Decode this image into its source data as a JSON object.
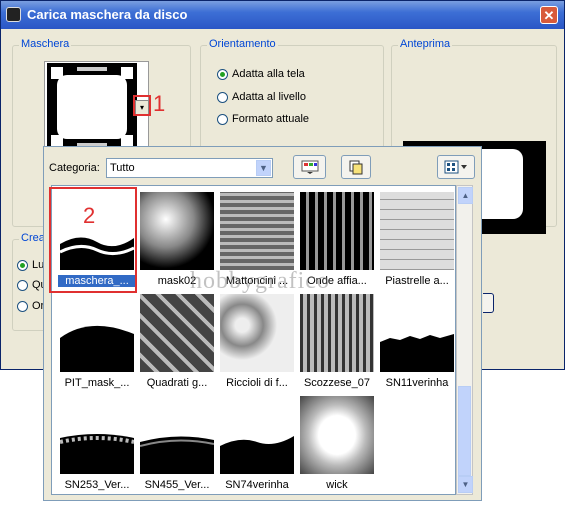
{
  "window": {
    "title": "Carica maschera da disco",
    "close_glyph": "✕"
  },
  "maschera": {
    "label": "Maschera",
    "annotation": "1"
  },
  "orientamento": {
    "label": "Orientamento",
    "options": [
      "Adatta alla tela",
      "Adatta al livello",
      "Formato attuale"
    ],
    "selected": "Adatta alla tela"
  },
  "anteprima": {
    "label": "Anteprima"
  },
  "crea": {
    "label": "Crea",
    "options": [
      "Lu",
      "Qu",
      "Or"
    ]
  },
  "popup": {
    "category_label": "Categoria:",
    "category_value": "Tutto",
    "annotation": "2",
    "items": [
      "maschera_...",
      "mask02",
      "Mattoncini ...",
      "Onde affia...",
      "Piastrelle a...",
      "PIT_mask_...",
      "Quadrati g...",
      "Riccioli di f...",
      "Scozzese_07",
      "SN11verinha",
      "SN253_Ver...",
      "SN455_Ver...",
      "SN74verinha",
      "wick"
    ],
    "selected_item": "maschera_..."
  },
  "watermark": "hobbygrafico",
  "colors": {
    "title_bar": "#2a56c6",
    "selection": "#316ac5",
    "annotation_red": "#e03030"
  }
}
